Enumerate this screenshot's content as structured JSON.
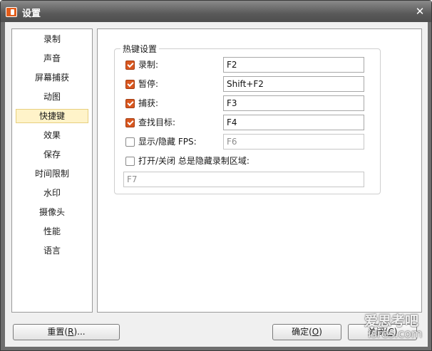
{
  "window": {
    "title": "设置"
  },
  "sidebar": {
    "items": [
      {
        "label": "录制"
      },
      {
        "label": "声音"
      },
      {
        "label": "屏幕捕获"
      },
      {
        "label": "动图"
      },
      {
        "label": "快捷键",
        "active": true
      },
      {
        "label": "效果"
      },
      {
        "label": "保存"
      },
      {
        "label": "时间限制"
      },
      {
        "label": "水印"
      },
      {
        "label": "摄像头"
      },
      {
        "label": "性能"
      },
      {
        "label": "语言"
      }
    ]
  },
  "hotkeys": {
    "group_title": "热键设置",
    "rows": [
      {
        "label": "录制:",
        "checked": true,
        "value": "F2",
        "enabled": true
      },
      {
        "label": "暂停:",
        "checked": true,
        "value": "Shift+F2",
        "enabled": true
      },
      {
        "label": "捕获:",
        "checked": true,
        "value": "F3",
        "enabled": true
      },
      {
        "label": "查找目标:",
        "checked": true,
        "value": "F4",
        "enabled": true
      },
      {
        "label": "显示/隐藏 FPS:",
        "checked": false,
        "value": "F6",
        "enabled": false
      },
      {
        "label": "打开/关闭 总是隐藏录制区域:",
        "checked": false,
        "value": "F7",
        "enabled": false
      }
    ]
  },
  "buttons": {
    "reset": {
      "text": "重置",
      "mnemonic": "R",
      "suffix": "..."
    },
    "ok": {
      "text": "确定",
      "mnemonic": "O"
    },
    "cancel": {
      "text": "关闭",
      "mnemonic": "C"
    }
  },
  "watermark": {
    "line1": "爱思考吧",
    "line2": "isres.com"
  },
  "colors": {
    "checkbox_checked": "#d9571f",
    "active_item_bg": "#fff3c9",
    "titlebar": "#5a5a5a"
  }
}
